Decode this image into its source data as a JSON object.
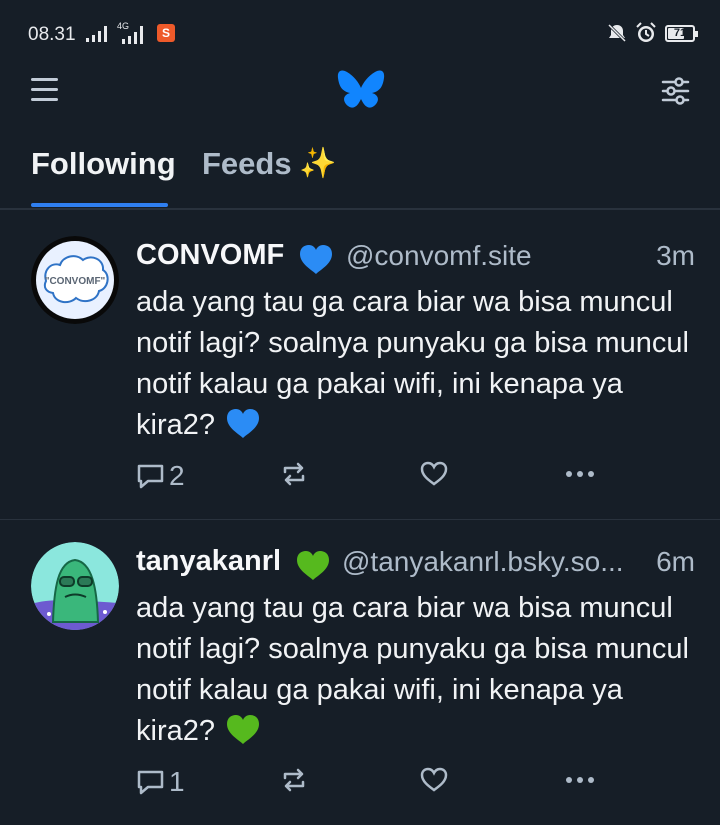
{
  "status_bar": {
    "time": "08.31",
    "network_label": "4G",
    "notification_app_icon": "shopee-icon",
    "battery_level": "71",
    "icons": [
      "signal-bars-icon",
      "signal-bars-icon",
      "shopee-icon",
      "do-not-disturb-icon",
      "alarm-icon",
      "battery-icon"
    ]
  },
  "header": {
    "menu_icon": "hamburger-menu-icon",
    "logo_icon": "bluesky-butterfly-icon",
    "filter_icon": "sliders-icon"
  },
  "tabs": [
    {
      "label": "Following",
      "active": true
    },
    {
      "label": "Feeds",
      "active": false,
      "icon": "sparkles-icon"
    }
  ],
  "posts": [
    {
      "display_name": "CONVOMF",
      "handle": "@convomf.site",
      "time": "3m",
      "text": "ada yang tau ga cara biar wa bisa muncul notif lagi? soalnya punyaku ga bisa muncul notif kalau ga pakai wifi, ini kenapa ya kira2? ",
      "heart_color": "#2b8cf5",
      "avatar_label": "\"CONVOMF\"",
      "replies": "2"
    },
    {
      "display_name": "tanyakanrl",
      "handle": "@tanyakanrl.bsky.so...",
      "time": "6m",
      "text": "ada yang tau ga cara biar wa bisa muncul notif lagi? soalnya punyaku ga bisa muncul notif kalau ga pakai wifi, ini kenapa ya kira2? ",
      "heart_color": "#56b91e",
      "replies": "1"
    }
  ],
  "colors": {
    "background": "#161e27",
    "accent": "#2f7ff0",
    "muted_text": "#aebbc9"
  }
}
